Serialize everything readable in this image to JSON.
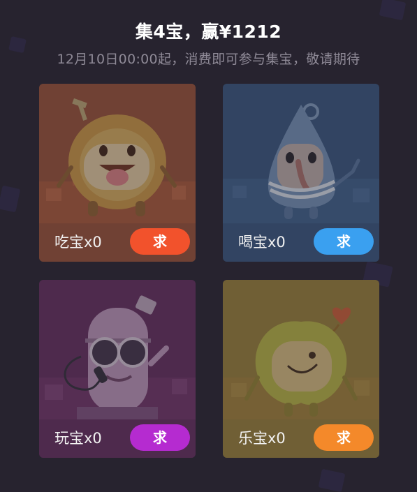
{
  "header": {
    "title": "集4宝，赢¥1212",
    "subtitle": "12月10日00:00起，消费即可参与集宝，敬请期待"
  },
  "cards": [
    {
      "name": "吃宝",
      "count_text": "吃宝x0",
      "button_label": "求",
      "bg_color": "#a35a3c",
      "button_color": "#f2522c",
      "icon": "tongue-mascot-icon"
    },
    {
      "name": "喝宝",
      "count_text": "喝宝x0",
      "button_label": "求",
      "bg_color": "#3f5e86",
      "button_color": "#3aa0f0",
      "icon": "drop-mascot-icon"
    },
    {
      "name": "玩宝",
      "count_text": "玩宝x0",
      "button_label": "求",
      "bg_color": "#6d3565",
      "button_color": "#b52bd0",
      "icon": "microphone-mascot-icon"
    },
    {
      "name": "乐宝",
      "count_text": "乐宝x0",
      "button_label": "求",
      "bg_color": "#a38a3e",
      "button_color": "#f4892a",
      "icon": "heart-mascot-icon"
    }
  ]
}
